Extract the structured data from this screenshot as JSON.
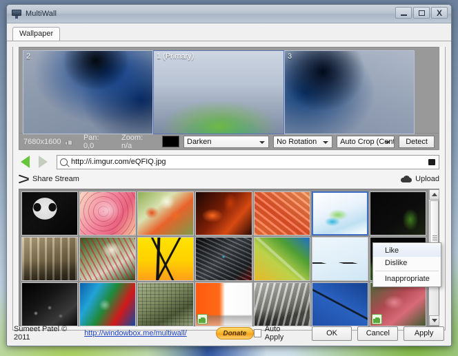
{
  "window": {
    "title": "MultiWall",
    "icon": "monitor-icon",
    "controls": {
      "minimize": "–",
      "maximize": "□",
      "close": "X"
    }
  },
  "tabs": [
    {
      "label": "Wallpaper",
      "active": true
    }
  ],
  "preview": {
    "monitors": [
      {
        "label": "2",
        "primary": false
      },
      {
        "label": "1 (Primary)",
        "primary": true
      },
      {
        "label": "3",
        "primary": false
      }
    ]
  },
  "toolbar": {
    "resolution": "7680x1600",
    "like_icon": "thumbs-up-icon",
    "pan": "Pan: 0,0",
    "zoom": "Zoom: n/a",
    "color_swatch": "#000000",
    "fill_mode": "Darken",
    "rotation": "No Rotation",
    "crop": "Auto Crop (Center",
    "detect_label": "Detect"
  },
  "urlbar": {
    "back_icon": "back-arrow-icon",
    "forward_icon": "forward-arrow-icon",
    "search_icon": "search-icon",
    "url": "http://i.imgur.com/eQFIQ.jpg",
    "end_icon": "image-icon"
  },
  "share": {
    "shuffle_icon": "shuffle-icon",
    "share_label": "Share Stream",
    "cloud_icon": "cloud-upload-icon",
    "upload_label": "Upload"
  },
  "grid": {
    "columns": 7,
    "rows": 3,
    "selected_index": 5,
    "liked_indices": [
      17,
      20
    ],
    "thumbnails": [
      {
        "name": "skull-art",
        "css": "linear-gradient(135deg,#0a0a0a 0%,#111 40%,#050505 100%)",
        "motif": "skull"
      },
      {
        "name": "pink-lily",
        "css": "linear-gradient(120deg,#f7d9c0 0%,#f28aa0 40%,#e8637f 70%,#f6c9a0 100%)",
        "motif": "flower"
      },
      {
        "name": "orange-poppies",
        "css": "linear-gradient(140deg,#8fae54 0%,#d9e2b0 35%,#e8622a 60%,#7f9a4a 100%)",
        "motif": "poppy"
      },
      {
        "name": "red-dragon",
        "css": "linear-gradient(130deg,#1a0603 0%,#7d1f06 45%,#d84a12 70%,#2a0a04 100%)",
        "motif": "dragon"
      },
      {
        "name": "orange-fabric",
        "css": "linear-gradient(35deg,#ff7a3c 0%,#f2562a 45%,#ff9a5c 100%)",
        "motif": "fabric"
      },
      {
        "name": "blue-white-abstract",
        "css": "linear-gradient(160deg,#ffffff 0%,#e8f2fb 45%,#bfe0f2 75%,#ffffff 100%)",
        "motif": "abstract"
      },
      {
        "name": "dark-leaf",
        "css": "linear-gradient(140deg,#060606 0%,#0d0d0d 60%,#1b2410 100%)",
        "motif": "leaf"
      },
      {
        "name": "stone-ruins",
        "css": "linear-gradient(160deg,#cdbb92 0%,#8e7d58 45%,#55492f 85%)",
        "motif": "ruins"
      },
      {
        "name": "baseball-grass",
        "css": "linear-gradient(150deg,#2f5a22 0%,#9aa477 40%,#d8d2c0 65%,#1f4a18 100%)",
        "motif": "baseball"
      },
      {
        "name": "yellow-tree",
        "css": "linear-gradient(180deg,#ffe300 0%,#ffd000 55%,#ff9f1a 100%)",
        "motif": "tree"
      },
      {
        "name": "mech-robot",
        "css": "linear-gradient(135deg,#0b0b0b 0%,#4a4f55 45%,#23262a 80%,#7a1410 100%)",
        "motif": "robot"
      },
      {
        "name": "green-yellow-curve",
        "css": "linear-gradient(40deg,#e8b82a 0%,#bcd24a 40%,#4f9e34 70%,#2070c8 100%)",
        "motif": "curve"
      },
      {
        "name": "paper-plane",
        "css": "linear-gradient(160deg,#eef6fb 0%,#dfeef8 60%,#cfe6f4 100%)",
        "motif": "plane"
      },
      {
        "name": "black-green",
        "css": "linear-gradient(200deg,#050505 0%,#0a0a0a 60%,#2e5a18 100%)",
        "motif": "dark"
      },
      {
        "name": "keyboard-macro",
        "css": "linear-gradient(140deg,#000 0%,#151515 40%,#3a3a3a 75%,#0a0a0a 100%)",
        "motif": "keys"
      },
      {
        "name": "paint-swirl",
        "css": "linear-gradient(120deg,#0d5ea8 0%,#21a3d8 25%,#1f8a3a 48%,#d11a1a 72%,#1447a0 100%)",
        "motif": "swirl"
      },
      {
        "name": "circuit-board",
        "css": "linear-gradient(150deg,#a8b48c 0%,#7e8c62 40%,#4e5c3a 70%,#97a67e 100%)",
        "motif": "circuit"
      },
      {
        "name": "orange-bottle",
        "css": "linear-gradient(90deg,#ff5a10 0%,#ff6a18 42%,#ffffff 52%,#fafafa 100%)",
        "motif": "bottle"
      },
      {
        "name": "architecture",
        "css": "linear-gradient(165deg,#d8d8d4 0%,#9a9a94 45%,#5e5e58 75%,#c9c9c4 100%)",
        "motif": "arch"
      },
      {
        "name": "blue-diagonal",
        "css": "linear-gradient(30deg,#1f4fa8 0%,#2a62c0 50%,#15408e 100%)",
        "motif": "diagonal"
      },
      {
        "name": "red-coral",
        "css": "linear-gradient(140deg,#4a6a3a 0%,#b04a52 40%,#d96a78 65%,#3e5a30 100%)",
        "motif": "coral"
      }
    ]
  },
  "context_menu": {
    "items": [
      {
        "label": "Like",
        "highlighted": true
      },
      {
        "label": "Dislike",
        "highlighted": false
      },
      {
        "label": "Inappropriate",
        "highlighted": false,
        "after_separator": true
      }
    ]
  },
  "footer": {
    "copyright": "Sumeet Patel © 2011",
    "link": "http://windowbox.me/multiwall/",
    "donate_label": "Donate",
    "auto_apply_label": "Auto Apply",
    "auto_apply_checked": false,
    "ok_label": "OK",
    "cancel_label": "Cancel",
    "apply_label": "Apply"
  }
}
